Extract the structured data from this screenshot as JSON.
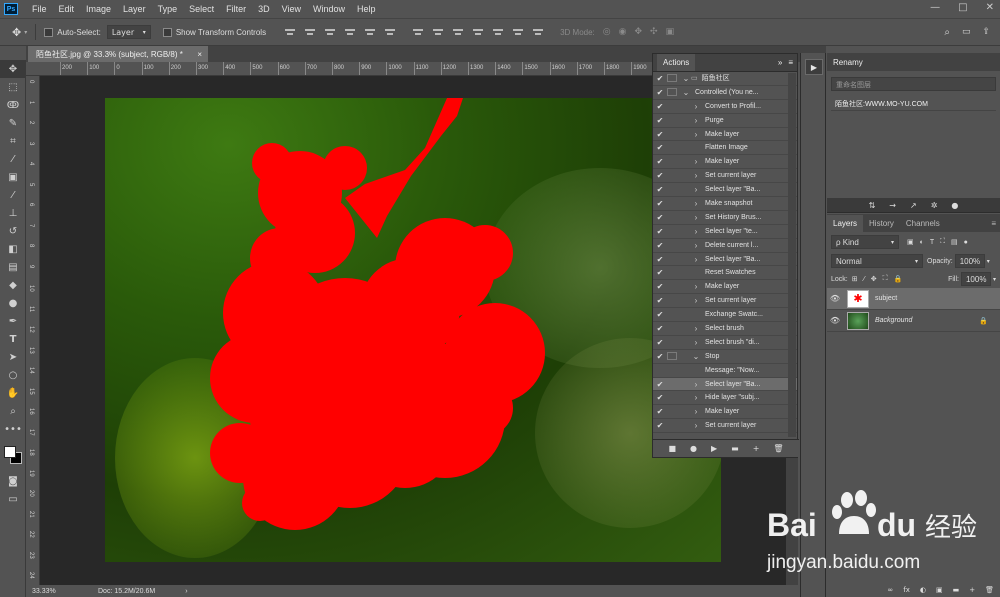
{
  "menu": {
    "logo": "Ps",
    "items": [
      "File",
      "Edit",
      "Image",
      "Layer",
      "Type",
      "Select",
      "Filter",
      "3D",
      "View",
      "Window",
      "Help"
    ],
    "window_controls": [
      "—",
      "□",
      "✕"
    ]
  },
  "options": {
    "auto_select_label": "Auto-Select:",
    "auto_select_value": "Layer",
    "show_transform_label": "Show Transform Controls",
    "mode_3d_label": "3D Mode:"
  },
  "document": {
    "tab_title": "陌鱼社区.jpg @ 33.3% (subject, RGB/8) *",
    "close": "×"
  },
  "rulers": {
    "h": [
      "200",
      "100",
      "0",
      "100",
      "200",
      "300",
      "400",
      "500",
      "600",
      "700",
      "800",
      "900",
      "1000",
      "1100",
      "1200",
      "1300",
      "1400",
      "1500",
      "1600",
      "1700",
      "1800",
      "1900",
      "2000",
      "2100",
      "2200",
      "2300"
    ],
    "v": [
      "0",
      "1",
      "2",
      "3",
      "4",
      "5",
      "6",
      "7",
      "8",
      "9",
      "10",
      "11",
      "12",
      "13",
      "14",
      "15",
      "16",
      "17",
      "18",
      "19",
      "20",
      "21",
      "22",
      "23",
      "24"
    ]
  },
  "status": {
    "zoom": "33.33%",
    "doc": "Doc: 15.2M/20.6M",
    "arrow": "›"
  },
  "actions": {
    "tab": "Actions",
    "menu": "≡",
    "collapse": "»",
    "set_name": "陌鱼社区",
    "rows": [
      {
        "label": "Controlled (You ne...",
        "check": "✔",
        "dialog": true,
        "tri": "⌄",
        "indent": 1
      },
      {
        "label": "Convert to Profil...",
        "check": "✔",
        "dialog": false,
        "tri": "›",
        "indent": 2
      },
      {
        "label": "Purge",
        "check": "✔",
        "dialog": false,
        "tri": "›",
        "indent": 2
      },
      {
        "label": "Make layer",
        "check": "✔",
        "dialog": false,
        "tri": "›",
        "indent": 2
      },
      {
        "label": "Flatten Image",
        "check": "✔",
        "dialog": false,
        "tri": "",
        "indent": 2
      },
      {
        "label": "Make layer",
        "check": "✔",
        "dialog": false,
        "tri": "›",
        "indent": 2
      },
      {
        "label": "Set current layer",
        "check": "✔",
        "dialog": false,
        "tri": "›",
        "indent": 2
      },
      {
        "label": "Select layer \"Ba...",
        "check": "✔",
        "dialog": false,
        "tri": "›",
        "indent": 2
      },
      {
        "label": "Make snapshot",
        "check": "✔",
        "dialog": false,
        "tri": "›",
        "indent": 2
      },
      {
        "label": "Set History Brus...",
        "check": "✔",
        "dialog": false,
        "tri": "›",
        "indent": 2
      },
      {
        "label": "Select layer \"te...",
        "check": "✔",
        "dialog": false,
        "tri": "›",
        "indent": 2
      },
      {
        "label": "Delete current l...",
        "check": "✔",
        "dialog": false,
        "tri": "›",
        "indent": 2
      },
      {
        "label": "Select layer \"Ba...",
        "check": "✔",
        "dialog": false,
        "tri": "›",
        "indent": 2
      },
      {
        "label": "Reset Swatches",
        "check": "✔",
        "dialog": false,
        "tri": "",
        "indent": 2
      },
      {
        "label": "Make layer",
        "check": "✔",
        "dialog": false,
        "tri": "›",
        "indent": 2
      },
      {
        "label": "Set current layer",
        "check": "✔",
        "dialog": false,
        "tri": "›",
        "indent": 2
      },
      {
        "label": "Exchange Swatc...",
        "check": "✔",
        "dialog": false,
        "tri": "",
        "indent": 2
      },
      {
        "label": "Select brush",
        "check": "✔",
        "dialog": false,
        "tri": "›",
        "indent": 2
      },
      {
        "label": "Select brush \"di...",
        "check": "✔",
        "dialog": false,
        "tri": "›",
        "indent": 2
      },
      {
        "label": "Stop",
        "check": "✔",
        "dialog": true,
        "tri": "⌄",
        "indent": 2
      },
      {
        "label": "Message: \"Now...",
        "check": "",
        "dialog": false,
        "tri": "",
        "indent": 2
      },
      {
        "label": "Select layer \"Ba...",
        "check": "✔",
        "dialog": false,
        "tri": "›",
        "indent": 2,
        "selected": true
      },
      {
        "label": "Hide layer \"subj...",
        "check": "✔",
        "dialog": false,
        "tri": "›",
        "indent": 2
      },
      {
        "label": "Make layer",
        "check": "✔",
        "dialog": false,
        "tri": "›",
        "indent": 2
      },
      {
        "label": "Set current layer",
        "check": "✔",
        "dialog": false,
        "tri": "›",
        "indent": 2
      }
    ],
    "footer_icons": [
      "■",
      "●",
      "▶",
      "▬",
      "+",
      "🗑"
    ]
  },
  "play": {
    "icon": "▶"
  },
  "rename": {
    "tab": "Renamy",
    "placeholder": "重命名图层",
    "url": "陌鱼社区:WWW.MO-YU.COM",
    "icons": [
      "⇅",
      "→",
      "↗",
      "✲",
      "●"
    ]
  },
  "layers": {
    "tabs": [
      "Layers",
      "History",
      "Channels"
    ],
    "filter_label": "ρ Kind",
    "blend": "Normal",
    "opacity_label": "Opacity:",
    "opacity": "100%",
    "lock_label": "Lock:",
    "fill_label": "Fill:",
    "fill": "100%",
    "items": [
      {
        "name": "subject",
        "selected": true,
        "locked": false
      },
      {
        "name": "Background",
        "selected": false,
        "locked": true
      }
    ],
    "footer_icons": [
      "∞",
      "fx",
      "◐",
      "▣",
      "▬",
      "+",
      "🗑"
    ]
  },
  "watermark": {
    "brand_bai": "Bai",
    "brand_du": "du",
    "brand_cn": "经验",
    "url": "jingyan.baidu.com"
  },
  "colors": {
    "subject_mask": "#ff0000",
    "panel_bg": "#535353",
    "baidu_blue": "#2932e1",
    "baidu_red": "#e10602"
  }
}
